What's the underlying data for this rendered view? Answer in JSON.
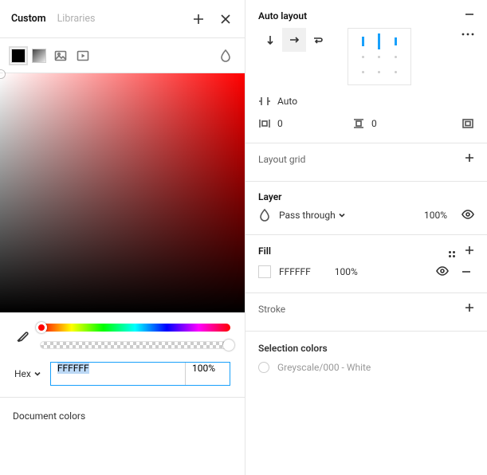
{
  "colorPicker": {
    "tabs": {
      "custom": "Custom",
      "libraries": "Libraries"
    },
    "hexLabel": "Hex",
    "hexValue": "FFFFFF",
    "opacityValue": "100%",
    "documentColorsLabel": "Document colors"
  },
  "autoLayout": {
    "title": "Auto layout",
    "spacingMode": "Auto",
    "paddingH": "0",
    "paddingV": "0"
  },
  "layoutGrid": {
    "title": "Layout grid"
  },
  "layer": {
    "title": "Layer",
    "blendMode": "Pass through",
    "opacity": "100%"
  },
  "fill": {
    "title": "Fill",
    "items": [
      {
        "hex": "FFFFFF",
        "opacity": "100%"
      }
    ]
  },
  "stroke": {
    "title": "Stroke"
  },
  "selectionColors": {
    "title": "Selection colors",
    "items": [
      {
        "label": "Greyscale/000 - White"
      }
    ]
  }
}
